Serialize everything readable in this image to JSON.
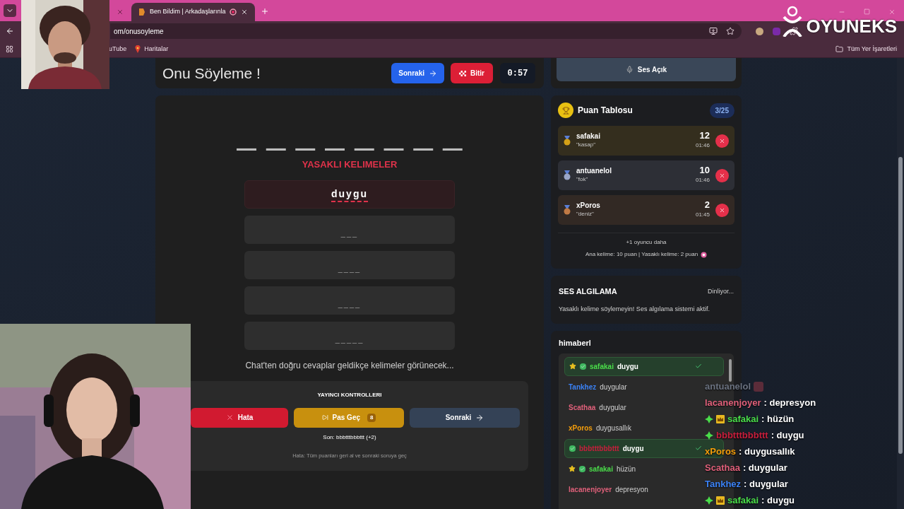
{
  "browser": {
    "tabs": [
      {
        "selected": false
      },
      {
        "title": "Ben Bildim | Arkadaşlarınla",
        "recording": true,
        "selected": true
      }
    ],
    "url": "om/onusoyleme",
    "bookmarks": [
      "uTube",
      "Haritalar"
    ],
    "all_bookmarks": "Tüm Yer İşaretleri"
  },
  "logo": "OYUNEKS",
  "game": {
    "title": "Onu Söyleme !",
    "next": "Sonraki",
    "finish": "Bitir",
    "timer": "0:57",
    "word_mask": "________",
    "forbidden_title": "YASAKLI KELIMELER",
    "forbidden": [
      {
        "revealed": true,
        "text": "duygu"
      },
      {
        "revealed": false,
        "text": "___"
      },
      {
        "revealed": false,
        "text": "____"
      },
      {
        "revealed": false,
        "text": "____"
      },
      {
        "revealed": false,
        "text": "_____"
      }
    ],
    "hint": "Chat'ten doğru cevaplar geldikçe kelimeler görünecek...",
    "controls": {
      "title": "YAYINCI KONTROLLERI",
      "error": "Hata",
      "pass": "Pas Geç",
      "pass_count": "8",
      "next": "Sonraki",
      "last": "Son: bbbtttbbbttt (+2)",
      "note": "Hata: Tüm puanları geri al ve sonraki soruya geç"
    }
  },
  "sound_button": "Ses Açık",
  "scoreboard": {
    "title": "Puan Tablosu",
    "round": "3/25",
    "rows": [
      {
        "name": "safakai",
        "word": "\"kasap\"",
        "score": "12",
        "time": "01:46",
        "color": "#d4a017"
      },
      {
        "name": "antuanelol",
        "word": "\"fok\"",
        "score": "10",
        "time": "01:46",
        "color": "#9aa6c8"
      },
      {
        "name": "xPoros",
        "word": "\"deniz\"",
        "score": "2",
        "time": "01:45",
        "color": "#c07a45"
      }
    ],
    "more": "+1 oyuncu daha",
    "rules": "Ana kelime: 10 puan | Yasaklı kelime: 2 puan"
  },
  "voice": {
    "title": "SES ALGILAMA",
    "status": "Dinliyor...",
    "text": "Yasaklı kelime söylemeyin! Ses algılama sistemi aktif."
  },
  "chat": {
    "channel": "himaberl",
    "messages": [
      {
        "user": "safakai",
        "color": "#4ade4a",
        "text": "duygu",
        "correct": true,
        "star": true,
        "check": true
      },
      {
        "user": "Tankhez",
        "color": "#3b82f6",
        "text": "duygular",
        "correct": false,
        "star": false,
        "check": false
      },
      {
        "user": "Scathaa",
        "color": "#e0607a",
        "text": "duygular",
        "correct": false,
        "star": false,
        "check": false
      },
      {
        "user": "xPoros",
        "color": "#f59e0b",
        "text": "duygusallık",
        "correct": false,
        "star": false,
        "check": false
      },
      {
        "user": "bbbtttbbbttt",
        "color": "#c81e3c",
        "text": "duygu",
        "correct": true,
        "star": false,
        "check": true
      },
      {
        "user": "safakai",
        "color": "#4ade4a",
        "text": "hüzün",
        "correct": false,
        "star": true,
        "check": true
      },
      {
        "user": "lacanenjoyer",
        "color": "#e0607a",
        "text": "depresyon",
        "correct": false,
        "star": false,
        "check": false
      }
    ]
  },
  "stream_chat": [
    {
      "user": "antuanelol",
      "color": "#6b7280",
      "diamond": false,
      "crown": false
    },
    {
      "user": "lacanenjoyer",
      "color": "#e0607a",
      "text": ": depresyon",
      "diamond": false,
      "crown": false
    },
    {
      "user": "safakai",
      "color": "#4ade4a",
      "text": ": hüzün",
      "diamond": true,
      "crown": true
    },
    {
      "user": "bbbtttbbbttt",
      "color": "#c81e3c",
      "text": ": duygu",
      "diamond": true,
      "crown": false
    },
    {
      "user": "xPoros",
      "color": "#f59e0b",
      "text": ": duygusallık",
      "diamond": false,
      "crown": false
    },
    {
      "user": "Scathaa",
      "color": "#e0607a",
      "text": ": duygular",
      "diamond": false,
      "crown": false
    },
    {
      "user": "Tankhez",
      "color": "#3b82f6",
      "text": ": duygular",
      "diamond": false,
      "crown": false
    },
    {
      "user": "safakai",
      "color": "#4ade4a",
      "text": ": duygu",
      "diamond": true,
      "crown": true
    }
  ]
}
